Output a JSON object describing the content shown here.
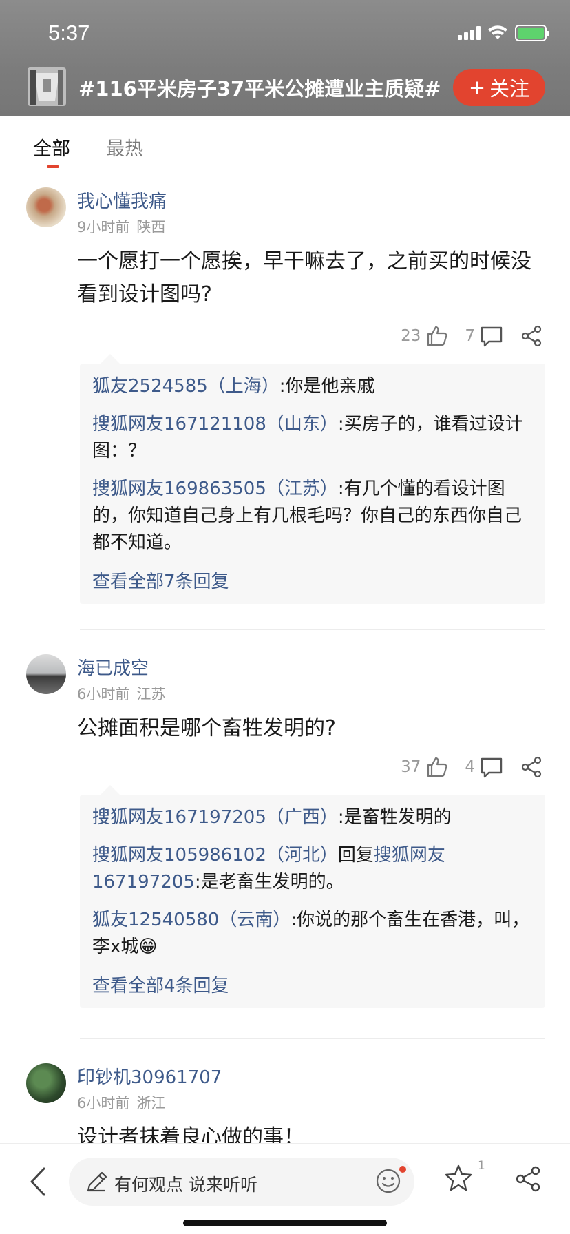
{
  "status_bar": {
    "time": "5:37"
  },
  "header": {
    "topic_title": "#116平米房子37平米公摊遭业主质疑#",
    "follow_label": "关注",
    "follow_plus": "+"
  },
  "tabs": [
    {
      "label": "全部",
      "active": true
    },
    {
      "label": "最热",
      "active": false
    }
  ],
  "comments": [
    {
      "username": "我心懂我痛",
      "time": "9小时前",
      "location": "陕西",
      "content": "一个愿打一个愿挨，早干嘛去了，之前买的时候没看到设计图吗?",
      "likes": "23",
      "reply_count": "7",
      "replies": [
        {
          "author": "狐友2524585（上海）",
          "text": ":你是他亲戚"
        },
        {
          "author": "搜狐网友167121108（山东）",
          "text": ":买房子的，谁看过设计图：？"
        },
        {
          "author": "搜狐网友169863505（江苏）",
          "text": ":有几个懂的看设计图的，你知道自己身上有几根毛吗？你自己的东西你自己都不知道。"
        }
      ],
      "view_all": "查看全部7条回复"
    },
    {
      "username": "海已成空",
      "time": "6小时前",
      "location": "江苏",
      "content": "公摊面积是哪个畜牲发明的?",
      "likes": "37",
      "reply_count": "4",
      "replies": [
        {
          "author": "搜狐网友167197205（广西）",
          "text": ":是畜牲发明的"
        },
        {
          "author": "搜狐网友105986102（河北）",
          "mid": "回复",
          "target": "搜狐网友167197205",
          "text": ":是老畜生发明的。"
        },
        {
          "author": "狐友12540580（云南）",
          "text": ":你说的那个畜生在香港，叫，李x城😁"
        }
      ],
      "view_all": "查看全部4条回复"
    },
    {
      "username": "印钞机30961707",
      "time": "6小时前",
      "location": "浙江",
      "content": "设计者抹着良心做的事！"
    }
  ],
  "bottom_bar": {
    "input_placeholder": "有何观点 说来听听",
    "star_count": "1"
  },
  "colors": {
    "accent": "#e2442f",
    "link": "#3e5a8a",
    "header_bg": "#808080"
  },
  "icons": [
    "back-icon",
    "pencil-icon",
    "emoji-icon",
    "star-icon",
    "share-icon",
    "thumbs-up-icon",
    "comment-icon",
    "signal-icon",
    "wifi-icon",
    "battery-icon"
  ]
}
